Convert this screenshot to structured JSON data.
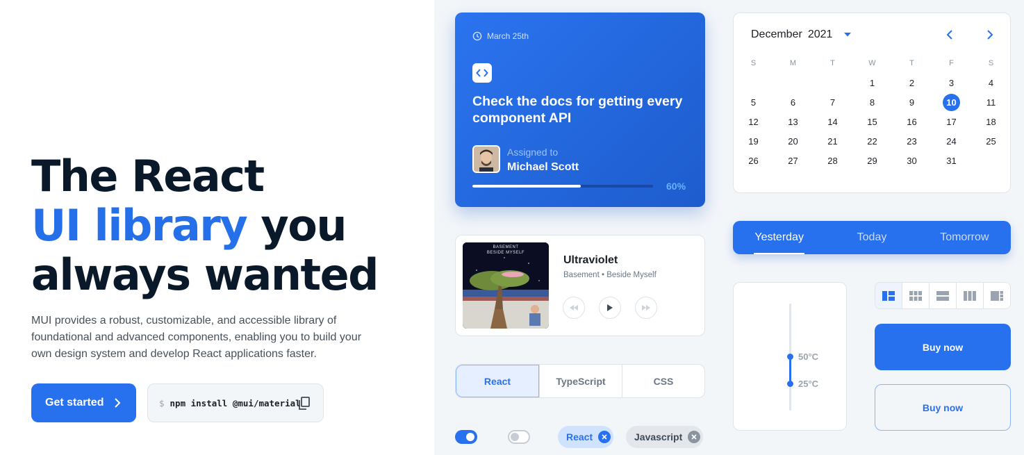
{
  "hero": {
    "line1": "The React",
    "highlight": "UI library",
    "line2_rest": " you",
    "line3": "always wanted",
    "description": "MUI provides a robust, customizable, and accessible library of foundational and advanced components, enabling you to build your own design system and develop React applications faster.",
    "cta_label": "Get started",
    "npm_prompt": "$",
    "npm_command": "npm install @mui/material"
  },
  "task_card": {
    "date": "March 25th",
    "title": "Check the docs for getting every component API",
    "assigned_label": "Assigned to",
    "assignee": "Michael Scott",
    "progress_label": "60%",
    "progress": 0.6
  },
  "calendar": {
    "month": "December",
    "year": "2021",
    "weekdays": [
      "S",
      "M",
      "T",
      "W",
      "T",
      "F",
      "S"
    ],
    "weeks": [
      [
        "",
        "",
        "",
        "1",
        "2",
        "3",
        "4"
      ],
      [
        "5",
        "6",
        "7",
        "8",
        "9",
        "10",
        "11"
      ],
      [
        "12",
        "13",
        "14",
        "15",
        "16",
        "17",
        "18"
      ],
      [
        "19",
        "20",
        "21",
        "22",
        "23",
        "24",
        "25"
      ],
      [
        "26",
        "27",
        "28",
        "29",
        "30",
        "31",
        ""
      ]
    ],
    "selected": "10"
  },
  "player": {
    "song": "Ultraviolet",
    "artist": "Basement • Beside Myself",
    "album_text_1": "BASEMENT",
    "album_text_2": "BESIDE MYSELF"
  },
  "tabs": [
    "Yesterday",
    "Today",
    "Tomorrow"
  ],
  "toggle_group": [
    "React",
    "TypeScript",
    "CSS"
  ],
  "chips": {
    "chip1": "React",
    "chip2": "Javascript"
  },
  "slider": {
    "high_label": "50°C",
    "low_label": "25°C",
    "high": 50,
    "low": 25
  },
  "buttons": {
    "buy_contained": "Buy now",
    "buy_outlined": "Buy now"
  },
  "colors": {
    "primary": "#2770ee",
    "heading": "#0a1929",
    "accent_text": "#2570e8"
  }
}
